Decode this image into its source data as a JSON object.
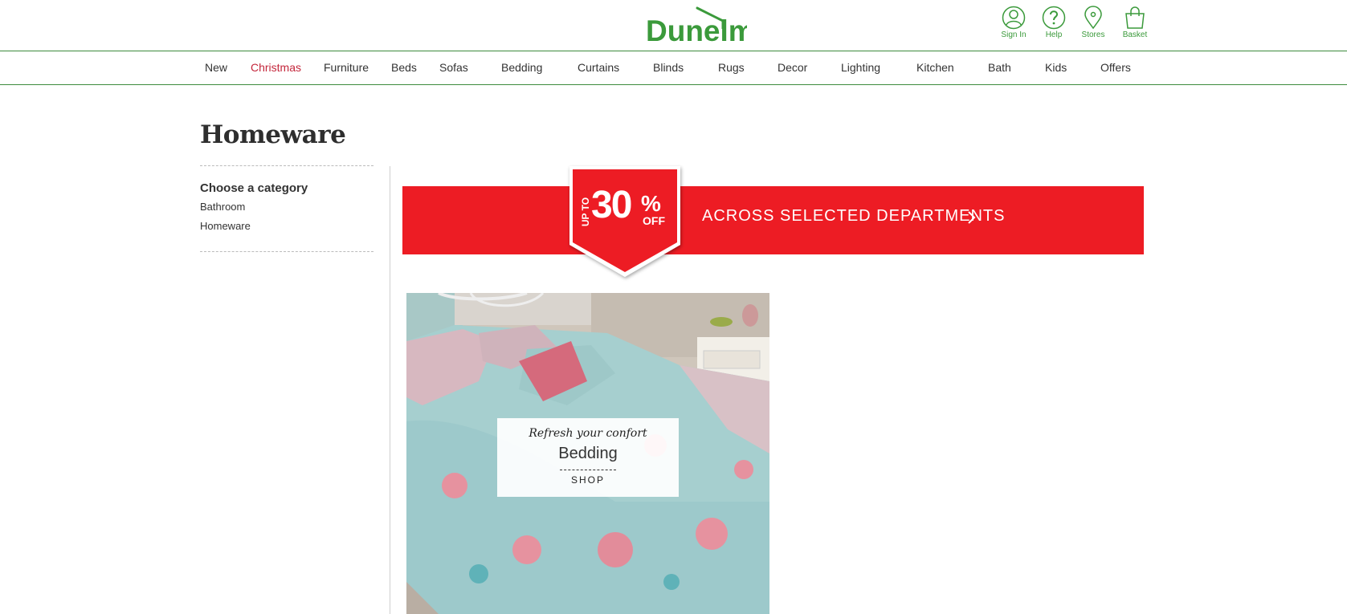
{
  "brand": {
    "logo_text": "Dunelm",
    "color": "#3b9a3b"
  },
  "header": {
    "utilities": [
      {
        "label": "Sign In",
        "icon": "user-icon"
      },
      {
        "label": "Help",
        "icon": "help-icon"
      },
      {
        "label": "Stores",
        "icon": "location-pin-icon"
      },
      {
        "label": "Basket",
        "icon": "basket-icon"
      }
    ]
  },
  "nav": {
    "items": [
      {
        "label": "New"
      },
      {
        "label": "Christmas",
        "active": true,
        "color": "#c4273c"
      },
      {
        "label": "Furniture"
      },
      {
        "label": "Beds"
      },
      {
        "label": "Sofas"
      },
      {
        "label": "Bedding"
      },
      {
        "label": "Curtains"
      },
      {
        "label": "Blinds"
      },
      {
        "label": "Rugs"
      },
      {
        "label": "Decor"
      },
      {
        "label": "Lighting"
      },
      {
        "label": "Kitchen"
      },
      {
        "label": "Bath"
      },
      {
        "label": "Kids"
      },
      {
        "label": "Offers"
      }
    ]
  },
  "page": {
    "title": "Homeware"
  },
  "sidebar": {
    "heading": "Choose a category",
    "links": [
      "Bathroom",
      "Homeware"
    ]
  },
  "promo": {
    "badge_upto": "UP TO",
    "badge_value": "30",
    "badge_percent": "%",
    "badge_off": "OFF",
    "text": "ACROSS SELECTED DEPARTMENTS",
    "color": "#ed1c24"
  },
  "card": {
    "tagline": "Refresh your confort",
    "title": "Bedding",
    "cta": "SHOP"
  }
}
